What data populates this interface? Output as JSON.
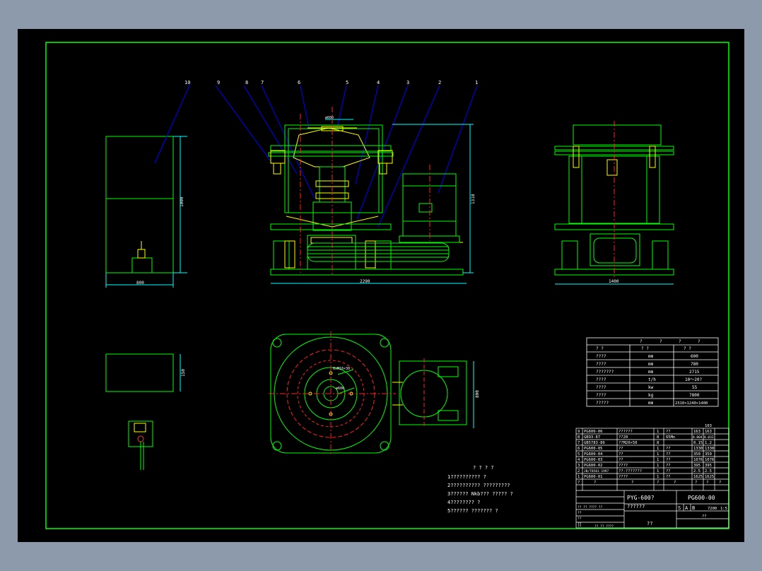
{
  "drawing": {
    "balloons": [
      "10",
      "9",
      "8",
      "7",
      "6",
      "5",
      "4",
      "3",
      "2",
      "1"
    ],
    "dims": {
      "front_width": "2290",
      "front_height": "1318",
      "side_width": "1400",
      "left_width": "800",
      "left_height": "1000",
      "small_box": "150",
      "plan_height": "800",
      "top_feed": "ø600",
      "plan_circle": "6xM16×30",
      "plan_inner": "ø600"
    }
  },
  "spec_table": {
    "header1": [
      "?",
      "?",
      "?",
      "?"
    ],
    "header2": [
      "?   ?",
      "?  ?",
      "?    ?"
    ],
    "rows": [
      [
        "????",
        "mm",
        "600"
      ],
      [
        "????",
        "mm",
        "780"
      ],
      [
        "???????",
        "mm",
        "2715"
      ],
      [
        "????",
        "t/h",
        "10～20?"
      ],
      [
        "????",
        "kw",
        "55"
      ],
      [
        "????",
        "kg",
        "7800"
      ],
      [
        "?????",
        "mm",
        "2310×1240×1400"
      ]
    ]
  },
  "notes": {
    "title": "? ? ? ?",
    "lines": [
      "1??????????   ?",
      "2??????????   ?????????",
      "3??????   Nkb???  ?????   ?",
      "4????????   ?",
      "5??????   ???????   ?"
    ]
  },
  "bom": {
    "top_label": "103",
    "rows": [
      [
        "9",
        "PG600-06",
        "??????",
        "1",
        "??",
        "163",
        "163"
      ],
      [
        "8",
        "GB93-87",
        "??20",
        "8",
        "65Mn",
        "0.004",
        "0.032"
      ],
      [
        "7",
        "GB5783-86",
        "??M20×50",
        "8",
        "",
        "0.15",
        "1.2"
      ],
      [
        "6",
        "PG600-05",
        "??",
        "1",
        "??",
        "1330",
        "1330"
      ],
      [
        "5",
        "PG600-04",
        "??",
        "1",
        "??",
        "350",
        "350"
      ],
      [
        "4",
        "PG600-03",
        "??",
        "1",
        "??",
        "1076",
        "1076"
      ],
      [
        "3",
        "PG600-02",
        "????",
        "1",
        "??",
        "395",
        "395"
      ],
      [
        "2",
        "JB/T8581-1997",
        "??-???????",
        "1",
        "??",
        "2.5",
        "2.5"
      ],
      [
        "1",
        "PG600-01",
        "????",
        "1",
        "??",
        "1625",
        "1625"
      ]
    ],
    "header": [
      "?",
      "?",
      "?",
      "?",
      "?",
      "?",
      "?",
      "?"
    ],
    "title_product": "PYG-600?",
    "title_sub": "??????",
    "drawing_no": "PG600-00",
    "stage_marks": [
      "S",
      "A",
      "B"
    ],
    "weight": "7200",
    "scale": "1:5",
    "sheet_total": "??",
    "footer": "??",
    "sign_labels": [
      "?? ?? ????  ?? ",
      "??",
      "??",
      "??",
      "??",
      "??  ?? ????"
    ]
  }
}
